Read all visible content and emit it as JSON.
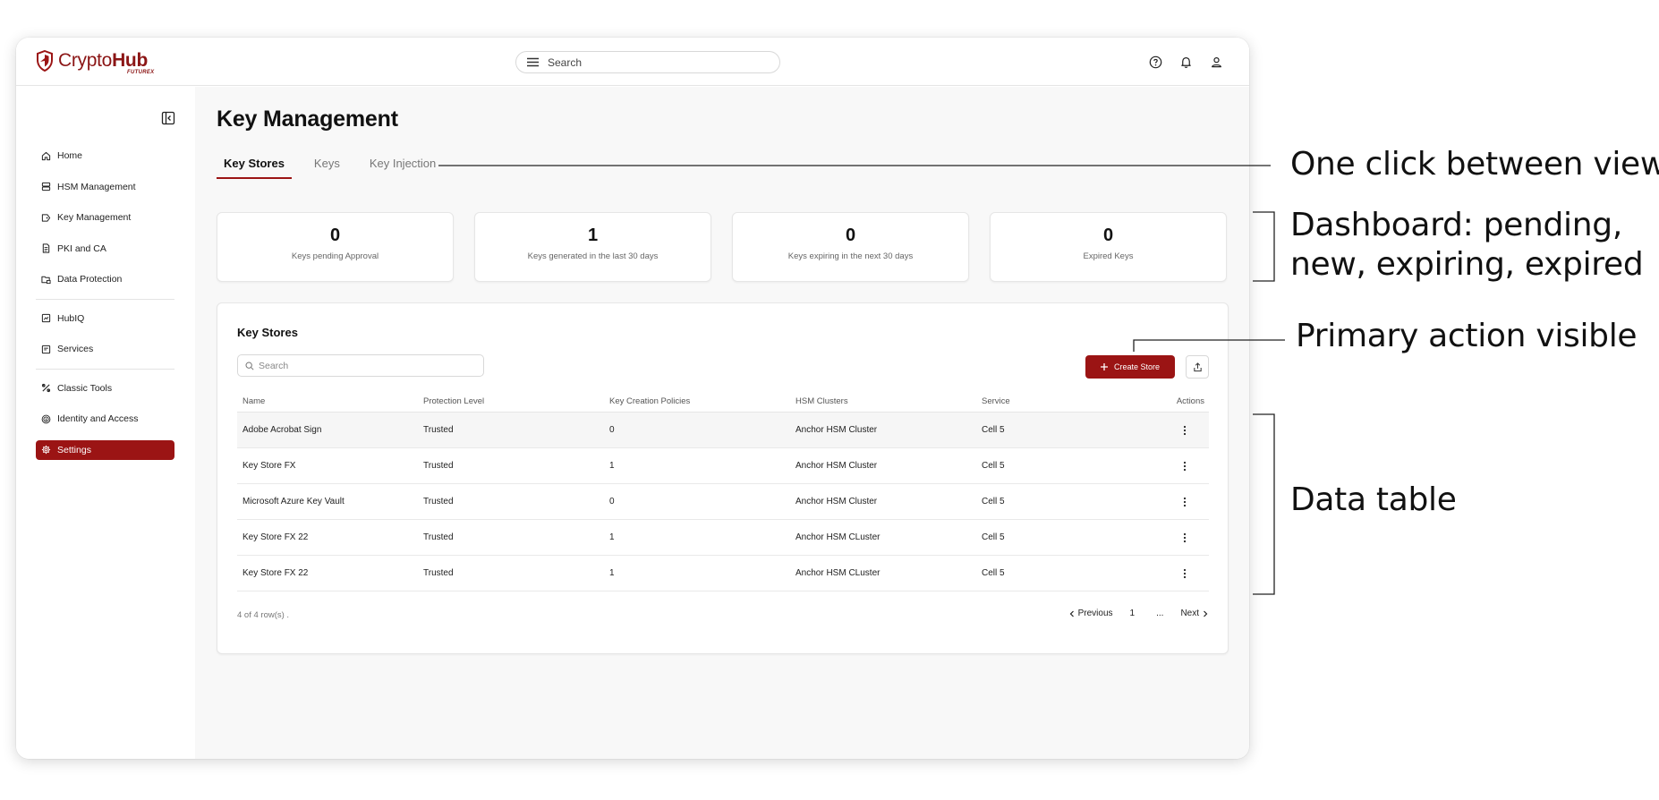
{
  "app": {
    "logo_part1": "Crypto",
    "logo_part2": "Hub",
    "logo_sub": "FUTUREX"
  },
  "topbar": {
    "search_placeholder": "Search"
  },
  "sidebar": {
    "items": [
      {
        "label": "Home",
        "icon": "home-icon"
      },
      {
        "label": "HSM Management",
        "icon": "server-icon"
      },
      {
        "label": "Key Management",
        "icon": "key-tag-icon"
      },
      {
        "label": "PKI and CA",
        "icon": "document-icon"
      },
      {
        "label": "Data Protection",
        "icon": "folder-lock-icon"
      },
      {
        "label": "HubIQ",
        "icon": "chart-icon"
      },
      {
        "label": "Services",
        "icon": "services-icon"
      },
      {
        "label": "Classic Tools",
        "icon": "tools-icon"
      },
      {
        "label": "Identity and Access",
        "icon": "fingerprint-icon"
      },
      {
        "label": "Settings",
        "icon": "gear-icon",
        "active": true
      }
    ]
  },
  "page": {
    "title": "Key Management",
    "tabs": [
      {
        "label": "Key Stores",
        "active": true
      },
      {
        "label": "Keys",
        "active": false
      },
      {
        "label": "Key Injection",
        "active": false
      }
    ]
  },
  "stats": [
    {
      "value": "0",
      "label": "Keys pending Approval"
    },
    {
      "value": "1",
      "label": "Keys generated in the last 30 days"
    },
    {
      "value": "0",
      "label": "Keys expiring in the next 30 days"
    },
    {
      "value": "0",
      "label": "Expired Keys"
    }
  ],
  "panel": {
    "title": "Key Stores",
    "search_placeholder": "Search",
    "create_label": "Create Store",
    "columns": [
      "Name",
      "Protection Level",
      "Key Creation Policies",
      "HSM Clusters",
      "Service",
      "Actions"
    ],
    "rows": [
      [
        "Adobe Acrobat Sign",
        "Trusted",
        "0",
        "Anchor HSM Cluster",
        "Cell 5"
      ],
      [
        "Key Store FX",
        "Trusted",
        "1",
        "Anchor HSM Cluster",
        "Cell 5"
      ],
      [
        "Microsoft Azure Key Vault",
        "Trusted",
        "0",
        "Anchor HSM Cluster",
        "Cell 5"
      ],
      [
        "Key Store FX 22",
        "Trusted",
        "1",
        "Anchor HSM CLuster",
        "Cell 5"
      ],
      [
        "Key Store FX 22",
        "Trusted",
        "1",
        "Anchor HSM CLuster",
        "Cell 5"
      ]
    ],
    "row_count": "4 of 4 row(s) .",
    "pager": {
      "previous": "Previous",
      "page": "1",
      "ellipsis": "...",
      "next": "Next"
    }
  },
  "annotations": {
    "tabs": "One click between views",
    "dashboard_line1": "Dashboard: pending,",
    "dashboard_line2": "new, expiring, expired",
    "primary": "Primary action visible",
    "table": "Data table"
  },
  "colors": {
    "brand": "#9b1414",
    "background": "#f8f8f8"
  }
}
